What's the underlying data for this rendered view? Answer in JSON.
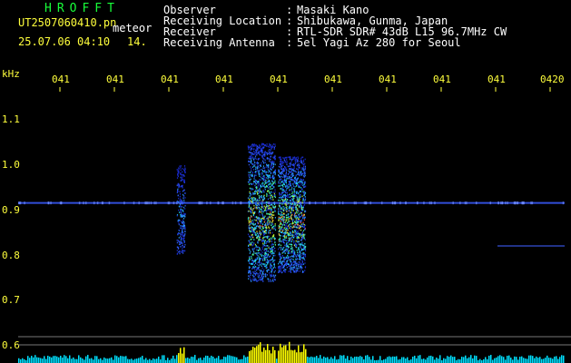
{
  "header": {
    "brand": "HROFFT",
    "filename": "UT2507060410.pn",
    "meteor_label": "meteor",
    "datetime": "25.07.06 04:10",
    "count": "14.",
    "fields": [
      {
        "label": "Observer",
        "value": "Masaki Kano"
      },
      {
        "label": "Receiving Location",
        "value": "Shibukawa, Gunma, Japan"
      },
      {
        "label": "Receiver",
        "value": "RTL-SDR SDR# 43dB L15 96.7MHz CW"
      },
      {
        "label": "Receiving Antenna",
        "value": "5el Yagi Az 280 for Seoul"
      }
    ],
    "separator": ":"
  },
  "axis": {
    "unit": "kHz",
    "freq_ticks": [
      "1.1",
      "1.0",
      "0.9",
      "0.8",
      "0.7",
      "0.6"
    ],
    "time_ticks": [
      "041",
      "041",
      "041",
      "041",
      "041",
      "041",
      "041",
      "041",
      "041",
      "0420"
    ]
  },
  "colors": {
    "background": "#000000",
    "brand": "#18ff3a",
    "text": "#ffffff",
    "axis": "#ffff3c",
    "signal_line": "#3a5cff",
    "spectrum_base": "#00e0ff",
    "spectrum_peak": "#ffff00"
  },
  "signal": {
    "carrier_khz": 0.915,
    "bursts": [
      {
        "name": "burst-a",
        "time_frac_start": 0.29,
        "time_frac_end": 0.305,
        "f_low": 0.8,
        "f_high": 1.0
      },
      {
        "name": "burst-b",
        "time_frac_start": 0.42,
        "time_frac_end": 0.47,
        "f_low": 0.74,
        "f_high": 1.05
      },
      {
        "name": "burst-c",
        "time_frac_start": 0.475,
        "time_frac_end": 0.525,
        "f_low": 0.76,
        "f_high": 1.02
      }
    ]
  }
}
